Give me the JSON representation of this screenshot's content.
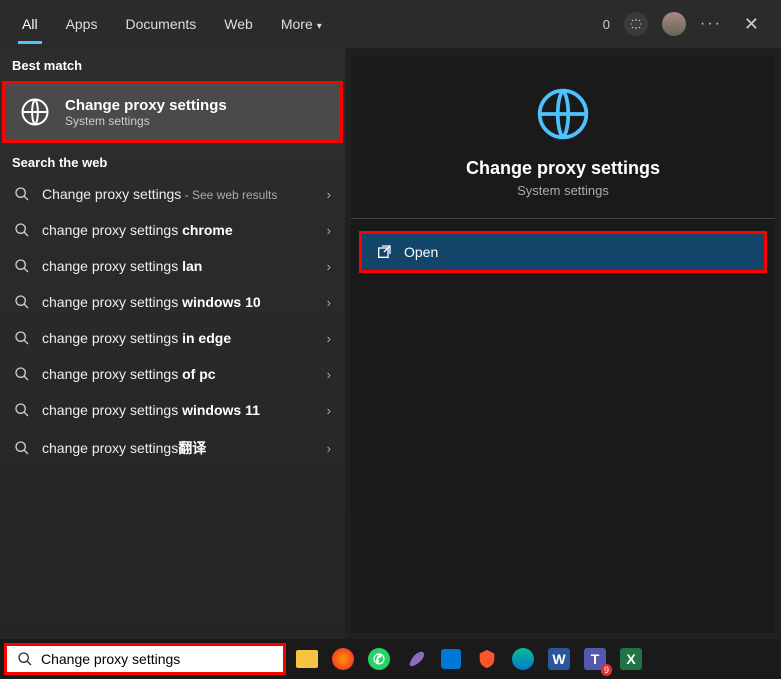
{
  "topbar": {
    "tabs": [
      "All",
      "Apps",
      "Documents",
      "Web",
      "More"
    ],
    "points": "0"
  },
  "left": {
    "best_match_label": "Best match",
    "best": {
      "title": "Change proxy settings",
      "sub": "System settings"
    },
    "web_label": "Search the web",
    "suggestions": [
      {
        "prefix": "Change proxy settings",
        "bold": "",
        "sub": " - See web results"
      },
      {
        "prefix": "change proxy settings ",
        "bold": "chrome",
        "sub": ""
      },
      {
        "prefix": "change proxy settings ",
        "bold": "lan",
        "sub": ""
      },
      {
        "prefix": "change proxy settings ",
        "bold": "windows 10",
        "sub": ""
      },
      {
        "prefix": "change proxy settings ",
        "bold": "in edge",
        "sub": ""
      },
      {
        "prefix": "change proxy settings ",
        "bold": "of pc",
        "sub": ""
      },
      {
        "prefix": "change proxy settings ",
        "bold": "windows 11",
        "sub": ""
      },
      {
        "prefix": "change proxy settings",
        "bold": "翻译",
        "sub": ""
      }
    ]
  },
  "detail": {
    "title": "Change proxy settings",
    "sub": "System settings",
    "open": "Open"
  },
  "search": {
    "value": "Change proxy settings"
  },
  "taskbar": {
    "teams_badge": "9"
  }
}
